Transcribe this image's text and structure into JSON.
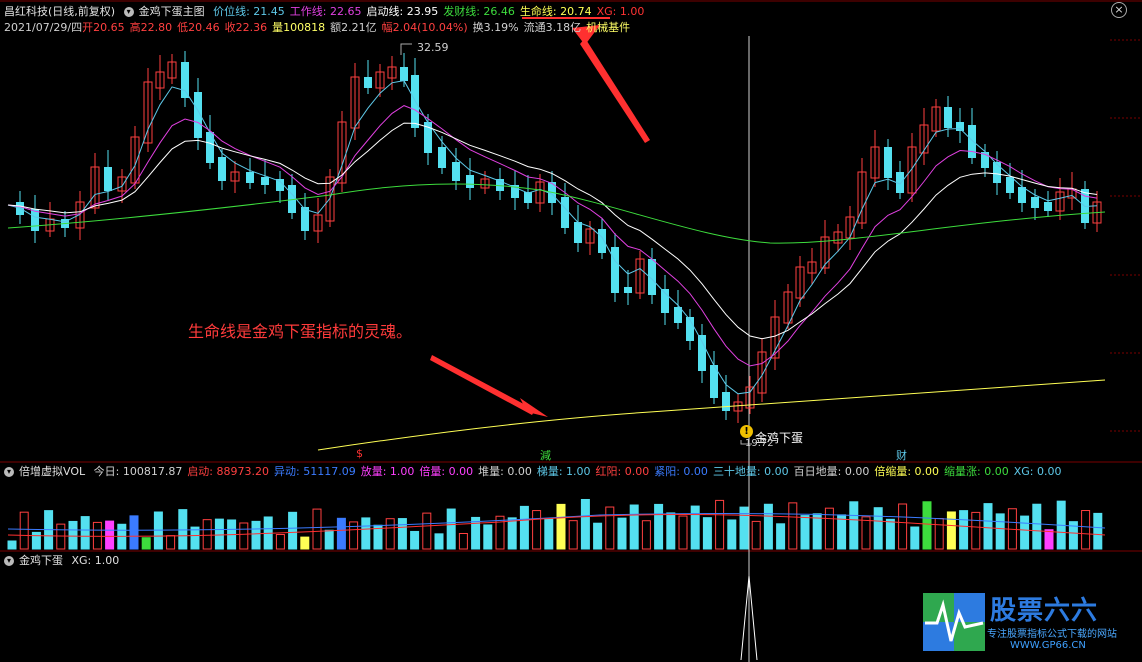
{
  "header": {
    "stock_name": "昌红科技",
    "period": "(日线,前复权)",
    "menu_glyph": "▾",
    "indicator_name": "金鸡下蛋主图",
    "lines": [
      {
        "label": "价位线: 21.45",
        "color": "#5ec8e8"
      },
      {
        "label": "工作线: 22.65",
        "color": "#e040e0"
      },
      {
        "label": "启动线: 23.95",
        "color": "#ffffff"
      },
      {
        "label": "发财线: 26.46",
        "color": "#3ddc3d"
      },
      {
        "label": "生命线: 20.74",
        "color": "#ffff55"
      },
      {
        "label": "XG: 1.00",
        "color": "#ff3333"
      }
    ],
    "close_glyph": "×"
  },
  "quote": {
    "date": "2021/07/29/四",
    "items": [
      {
        "text": "开20.65",
        "color": "#ff4040"
      },
      {
        "text": "高22.80",
        "color": "#ff4040"
      },
      {
        "text": "低20.46",
        "color": "#ff4040"
      },
      {
        "text": "收22.36",
        "color": "#ff4040"
      },
      {
        "text": "量100818",
        "color": "#ffff66"
      },
      {
        "text": "额2.21亿",
        "color": "#d0d0d0"
      },
      {
        "text": "幅2.04(10.04%)",
        "color": "#ff4040"
      },
      {
        "text": "换3.19%",
        "color": "#d0d0d0"
      },
      {
        "text": "流通3.18亿",
        "color": "#d0d0d0"
      },
      {
        "text": "机械基件",
        "color": "#ffff66"
      }
    ]
  },
  "annotations": {
    "main_text": "生命线是金鸡下蛋指标的灵魂。",
    "high_label": "32.59",
    "low_label": "19.72",
    "signal_label": "金鸡下蛋",
    "signal_icon": "!",
    "markers": [
      {
        "text": "$",
        "color": "#ff3333"
      },
      {
        "text": "減",
        "color": "#3ddc3d"
      },
      {
        "text": "财",
        "color": "#5ec8e8"
      }
    ]
  },
  "volume_panel": {
    "name": "倍增虚拟VOL",
    "items": [
      {
        "text": "今日: 100817.87",
        "color": "#d0d0d0"
      },
      {
        "text": "启动: 88973.20",
        "color": "#ff4040"
      },
      {
        "text": "异动: 51117.09",
        "color": "#3b7bff"
      },
      {
        "text": "放量: 1.00",
        "color": "#ff40ff"
      },
      {
        "text": "倍量: 0.00",
        "color": "#ff40ff"
      },
      {
        "text": "堆量: 0.00",
        "color": "#d0d0d0"
      },
      {
        "text": "梯量: 1.00",
        "color": "#5ec8e8"
      },
      {
        "text": "红阳: 0.00",
        "color": "#ff4040"
      },
      {
        "text": "紧阳: 0.00",
        "color": "#3b7bff"
      },
      {
        "text": "三十地量: 0.00",
        "color": "#5ec8e8"
      },
      {
        "text": "百日地量: 0.00",
        "color": "#d0d0d0"
      },
      {
        "text": "倍缩量: 0.00",
        "color": "#ffff55"
      },
      {
        "text": "缩量涨: 0.00",
        "color": "#3ddc3d"
      },
      {
        "text": "XG: 0.00",
        "color": "#5ec8e8"
      }
    ]
  },
  "signal_panel": {
    "name": "金鸡下蛋",
    "xg": "XG: 1.00"
  },
  "watermark": {
    "brand": "股票六六",
    "slogan": "专注股票指标公式下载的网站",
    "url": "WWW.GP66.CN"
  },
  "colors": {
    "up": "#ff4040",
    "down": "#54e0f0",
    "background": "#000000",
    "separator": "#7a0000"
  }
}
